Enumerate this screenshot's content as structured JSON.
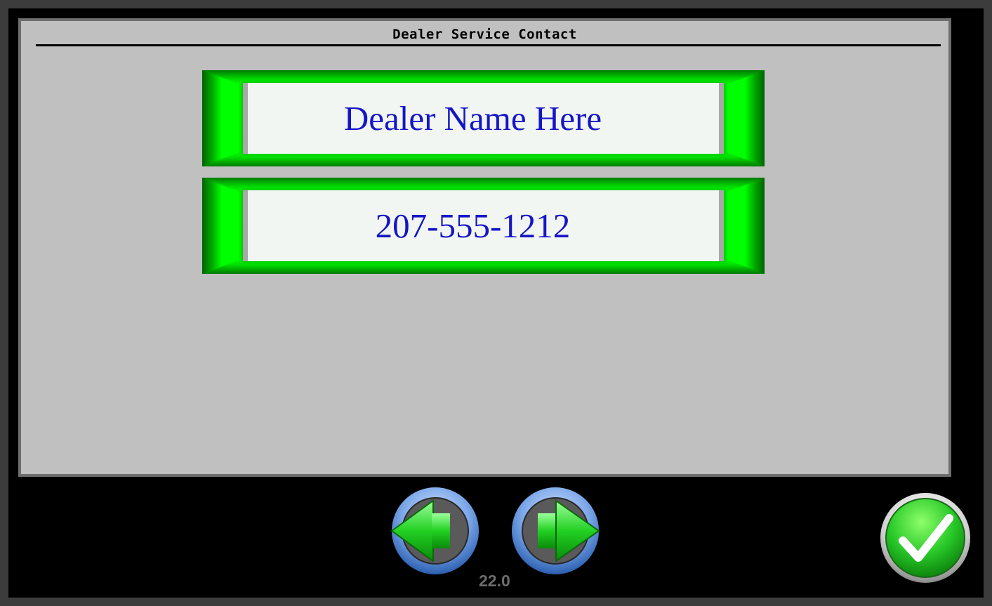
{
  "screen": {
    "title": "Dealer Service Contact"
  },
  "contact": {
    "dealer_name": "Dealer Name Here",
    "phone": "207-555-1212"
  },
  "footer": {
    "version": "22.0",
    "prev_icon": "left-arrow-icon",
    "next_icon": "right-arrow-icon",
    "confirm_icon": "checkmark-icon"
  },
  "colors": {
    "panel_bg": "#c0c0c0",
    "frame_green": "#00c800",
    "field_text": "#1515c8",
    "screen_bg": "#000000"
  }
}
